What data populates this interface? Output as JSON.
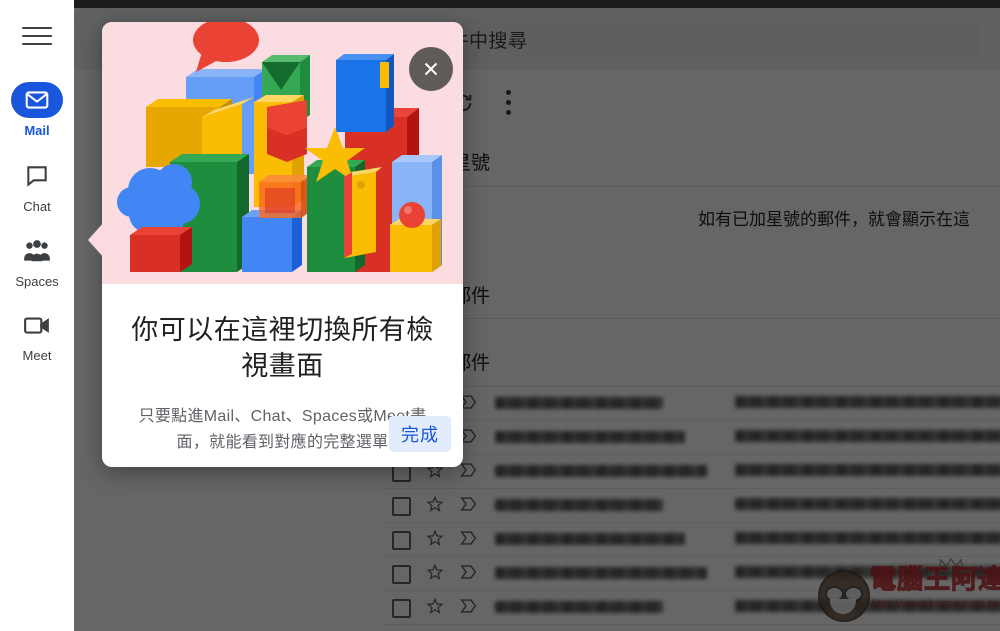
{
  "rail": {
    "menu_icon": "hamburger-icon",
    "items": [
      {
        "label": "Mail",
        "icon": "mail-icon",
        "active": true
      },
      {
        "label": "Chat",
        "icon": "chat-icon",
        "active": false
      },
      {
        "label": "Spaces",
        "icon": "spaces-icon",
        "active": false
      },
      {
        "label": "Meet",
        "icon": "meet-icon",
        "active": false
      }
    ]
  },
  "gmail": {
    "search_placeholder": "在郵件中搜尋",
    "search_visible_text": "郵件中搜尋",
    "refresh_icon": "refresh-icon",
    "more_icon": "more-vertical-icon",
    "sections": {
      "starred": "星號",
      "starred_visible": "星號",
      "mail_1": "郵件",
      "mail_2": "郵件"
    },
    "empty_note": "如有已加星號的郵件，就會顯示在這",
    "rows": [
      {
        "sender": "blurred",
        "subject": "blurred"
      },
      {
        "sender": "blurred",
        "subject": "blurred"
      },
      {
        "sender": "blurred",
        "subject": "blurred"
      },
      {
        "sender": "blurred",
        "subject": "blurred"
      },
      {
        "sender": "blurred",
        "subject": "blurred"
      },
      {
        "sender": "blurred",
        "subject": "blurred"
      },
      {
        "sender": "blurred",
        "subject": "blurred"
      }
    ]
  },
  "watermark": {
    "title": "電腦王阿達",
    "url": "http://www.kocpc.com.tw"
  },
  "dialog": {
    "close_icon": "close-icon",
    "hero_alt": "colorful-3d-blocks-illustration",
    "title": "你可以在這裡切換所有檢視畫面",
    "body": "只要點進Mail、Chat、Spaces或Meet畫面，就能看到對應的完整選單",
    "done_label": "完成"
  },
  "colors": {
    "accent_blue": "#1a56db",
    "hero_pink": "#fbdce1",
    "done_bg": "#e2ecfd",
    "scrim": "rgba(0,0,0,0.60)"
  }
}
